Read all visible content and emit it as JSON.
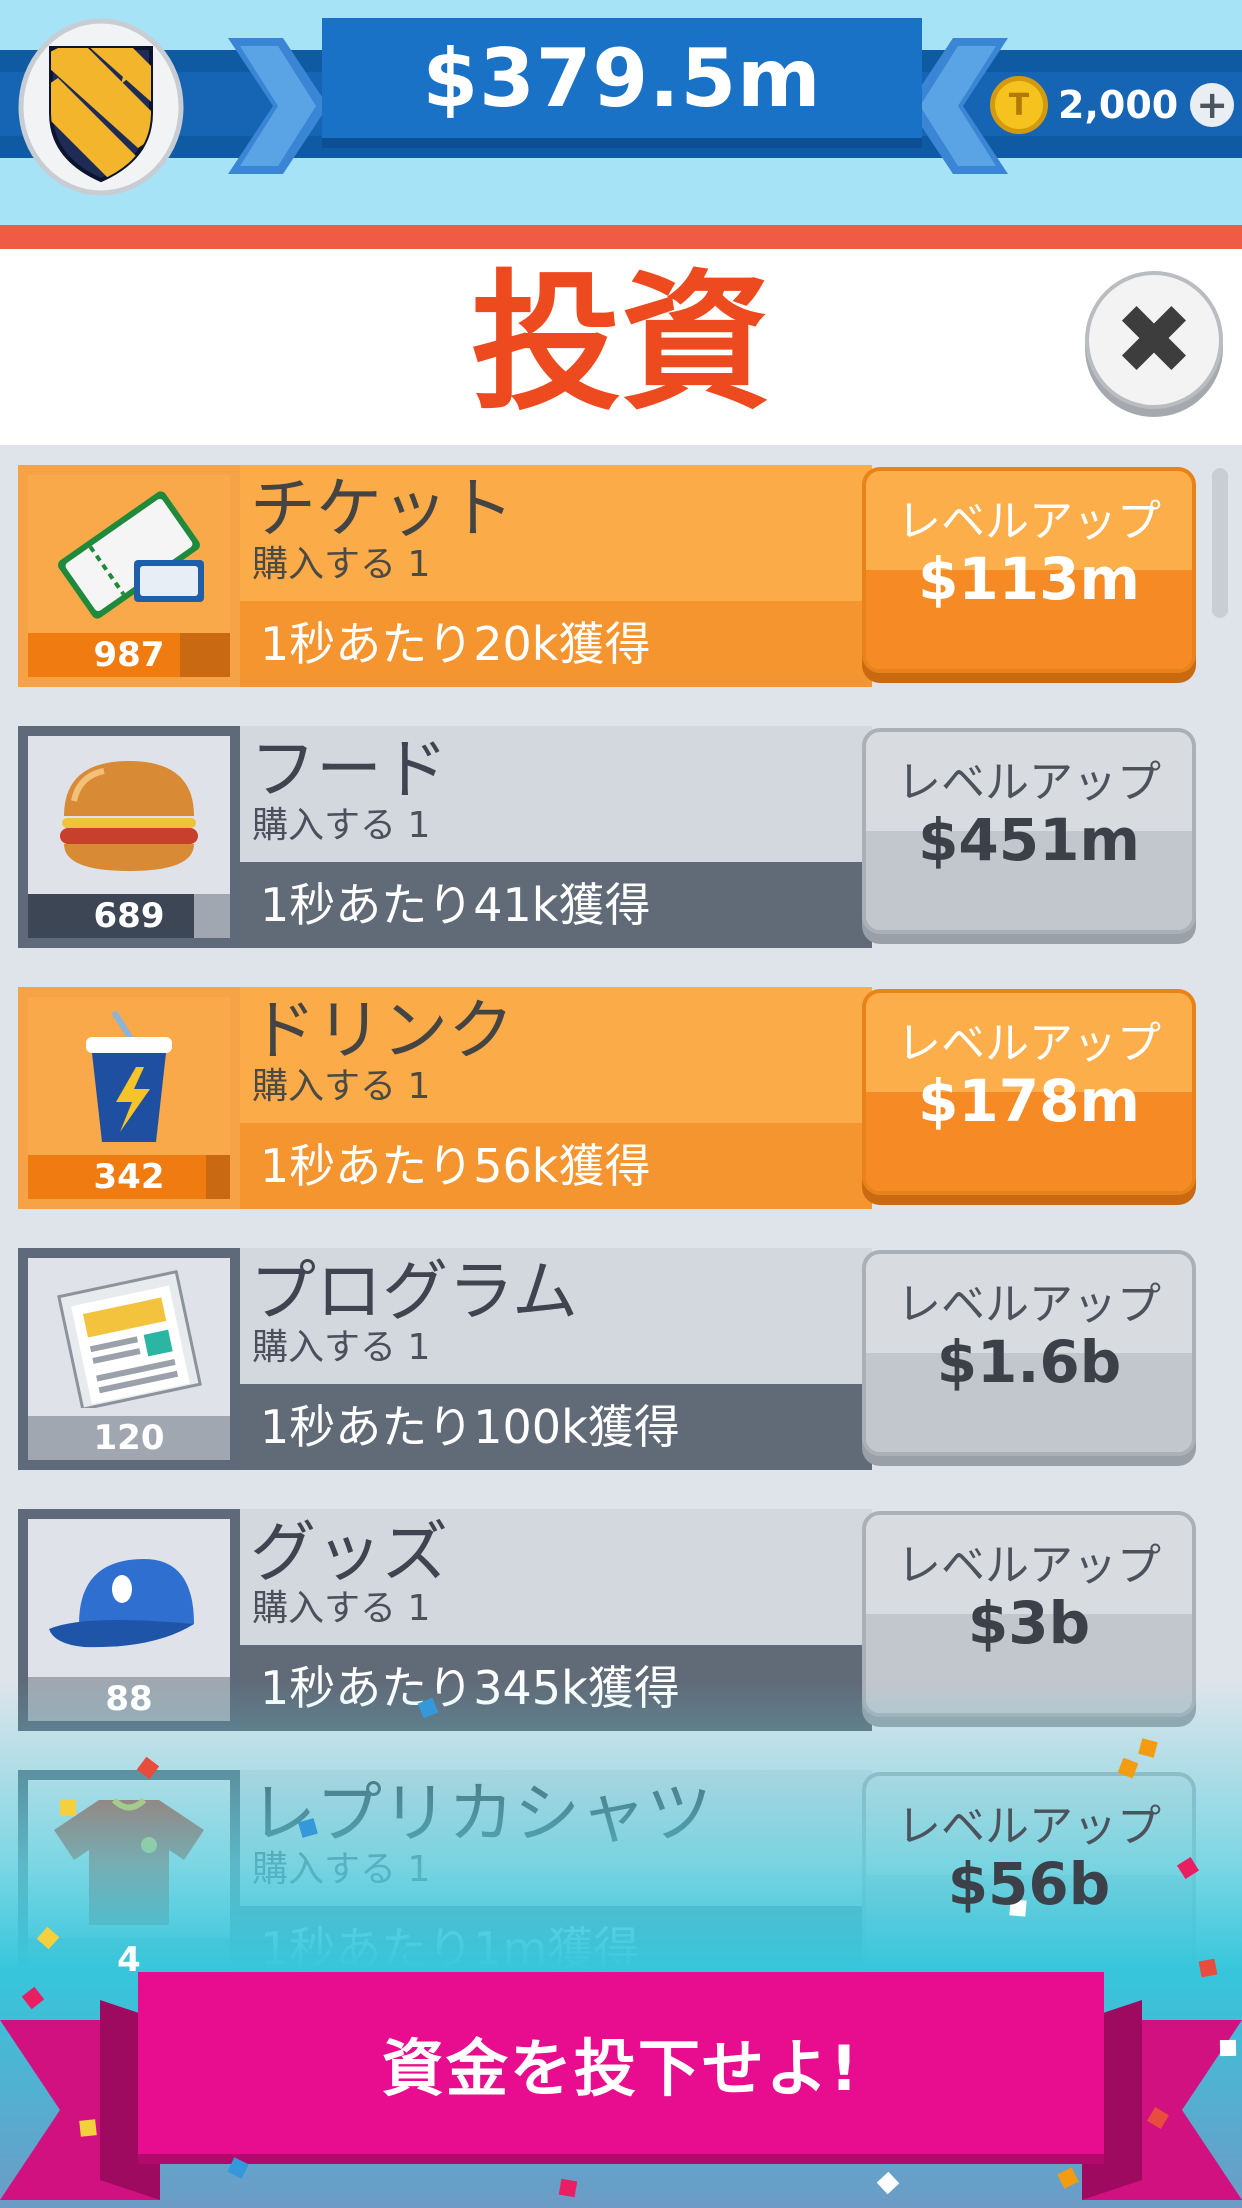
{
  "header": {
    "cash": "$379.5m",
    "coins": "2,000",
    "coin_symbol": "T",
    "plus_symbol": "+"
  },
  "title": "投資",
  "close_symbol": "✖",
  "colors": {
    "accent_orange": "#f59530",
    "title_red": "#ee4a1f",
    "invest_pink": "#e80c8f",
    "header_blue": "#1565b4"
  },
  "items": [
    {
      "name": "チケット",
      "sub": "購入する 1",
      "rate": "1秒あたり20k獲得",
      "count": "987",
      "progress": 0.75,
      "button_label": "レベルアップ",
      "price": "$113m",
      "affordable": true,
      "icon": "ticket-icon"
    },
    {
      "name": "フード",
      "sub": "購入する 1",
      "rate": "1秒あたり41k獲得",
      "count": "689",
      "progress": 0.82,
      "button_label": "レベルアップ",
      "price": "$451m",
      "affordable": false,
      "icon": "burger-icon"
    },
    {
      "name": "ドリンク",
      "sub": "購入する 1",
      "rate": "1秒あたり56k獲得",
      "count": "342",
      "progress": 0.88,
      "button_label": "レベルアップ",
      "price": "$178m",
      "affordable": true,
      "icon": "drink-icon"
    },
    {
      "name": "プログラム",
      "sub": "購入する 1",
      "rate": "1秒あたり100k獲得",
      "count": "120",
      "progress": 0.0,
      "button_label": "レベルアップ",
      "price": "$1.6b",
      "affordable": false,
      "icon": "newspaper-icon"
    },
    {
      "name": "グッズ",
      "sub": "購入する 1",
      "rate": "1秒あたり345k獲得",
      "count": "88",
      "progress": 0.0,
      "button_label": "レベルアップ",
      "price": "$3b",
      "affordable": false,
      "icon": "cap-icon"
    },
    {
      "name": "レプリカシャツ",
      "sub": "購入する 1",
      "rate": "1秒あたり1m獲得",
      "count": "4",
      "progress": 0.0,
      "button_label": "レベルアップ",
      "price": "$56b",
      "affordable": false,
      "icon": "shirt-icon"
    }
  ],
  "invest_button": "資金を投下せよ!"
}
